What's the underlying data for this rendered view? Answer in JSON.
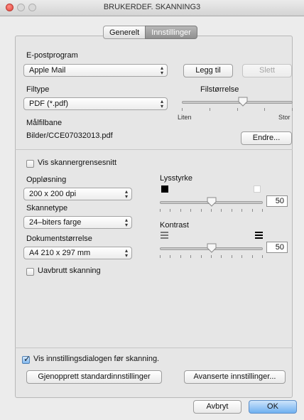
{
  "window": {
    "title": "BRUKERDEF. SKANNING3"
  },
  "tabs": [
    {
      "label": "Generelt"
    },
    {
      "label": "Innstillinger"
    }
  ],
  "email": {
    "label": "E-postprogram",
    "selected": "Apple Mail",
    "add_button": "Legg til",
    "delete_button": "Slett"
  },
  "filetype": {
    "label": "Filtype",
    "selected": "PDF (*.pdf)"
  },
  "filesize": {
    "label": "Filstørrelse",
    "min_label": "Liten",
    "max_label": "Stor",
    "level": 0.55
  },
  "target": {
    "label": "Målfilbane",
    "path": "Bilder/CCE07032013.pdf",
    "change_button": "Endre..."
  },
  "scanner": {
    "show_interface": "Vis skannergrensesnitt",
    "show_interface_checked": false,
    "resolution_label": "Oppløsning",
    "resolution": "200 x 200 dpi",
    "scan_type_label": "Skannetype",
    "scan_type": "24–biters farge",
    "doc_size_label": "Dokumentstørrelse",
    "doc_size": "A4 210 x 297 mm",
    "continuous": "Uavbrutt skanning",
    "continuous_checked": false
  },
  "brightness": {
    "label": "Lysstyrke",
    "value": "50",
    "level": 0.5
  },
  "contrast": {
    "label": "Kontrast",
    "value": "50",
    "level": 0.5
  },
  "footer": {
    "show_dialog": "Vis innstillingsdialogen før skanning.",
    "show_dialog_checked": true,
    "restore_button": "Gjenopprett standardinnstillinger",
    "advanced_button": "Avanserte innstillinger...",
    "cancel_button": "Avbryt",
    "ok_button": "OK"
  },
  "icons": {
    "brightness_low": "black-square-icon",
    "brightness_high": "white-square-icon",
    "contrast_low": "low-contrast-icon",
    "contrast_high": "high-contrast-icon",
    "popup_arrows": "updown-arrows-icon"
  }
}
